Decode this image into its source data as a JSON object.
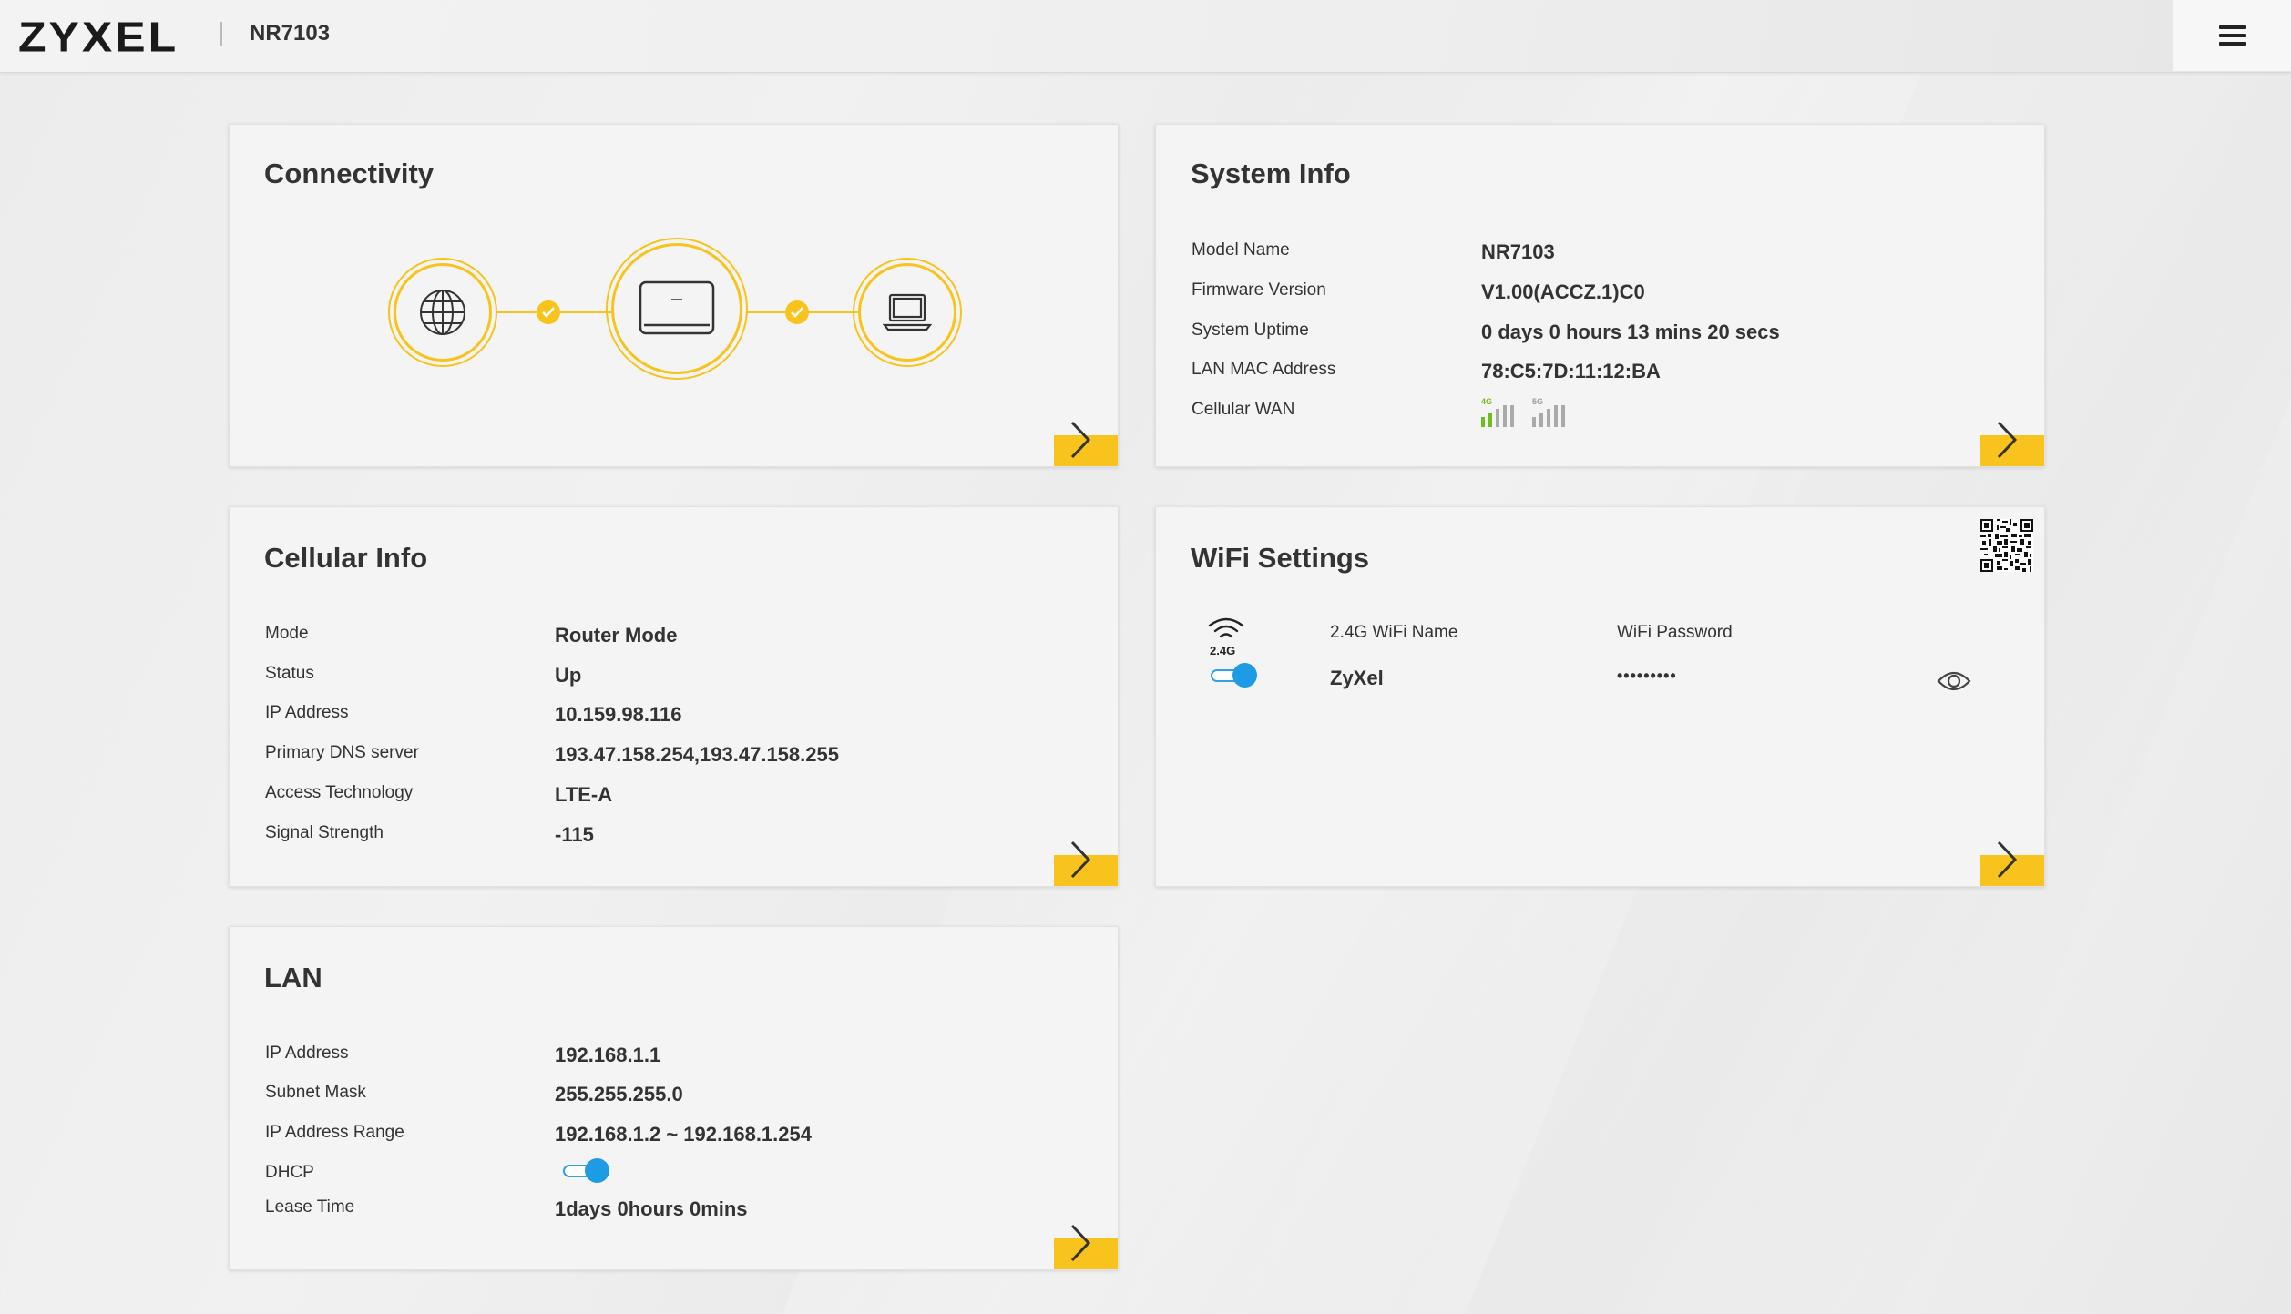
{
  "header": {
    "logo": "ZYXEL",
    "model": "NR7103",
    "menu_icon": "hamburger-menu-icon"
  },
  "accent_color": "#f7c31c",
  "toggle_color": "#1e9be5",
  "connectivity": {
    "title": "Connectivity",
    "nodes": [
      "globe-icon",
      "router-icon",
      "laptop-icon"
    ],
    "links_ok": [
      true,
      true
    ]
  },
  "system_info": {
    "title": "System Info",
    "rows": [
      {
        "label": "Model Name",
        "value": "NR7103"
      },
      {
        "label": "Firmware Version",
        "value": "V1.00(ACCZ.1)C0"
      },
      {
        "label": "System Uptime",
        "value": "0 days 0 hours 13 mins 20 secs"
      },
      {
        "label": "LAN MAC Address",
        "value": "78:C5:7D:11:12:BA"
      },
      {
        "label": "Cellular WAN",
        "value": ""
      }
    ],
    "cellular_wan": {
      "signal_4g_label": "4G",
      "signal_5g_label": "5G",
      "signal_4g_bars_active": 1,
      "signal_5g_bars_active": 0,
      "bars_total": 4
    }
  },
  "cellular_info": {
    "title": "Cellular Info",
    "rows": [
      {
        "label": "Mode",
        "value": "Router Mode"
      },
      {
        "label": "Status",
        "value": "Up"
      },
      {
        "label": "IP Address",
        "value": "10.159.98.116"
      },
      {
        "label": "Primary DNS server",
        "value": "193.47.158.254,193.47.158.255"
      },
      {
        "label": "Access Technology",
        "value": "LTE-A"
      },
      {
        "label": "Signal Strength",
        "value": "-115"
      }
    ]
  },
  "wifi_settings": {
    "title": "WiFi Settings",
    "band_label": "2.4G",
    "name_header": "2.4G WiFi Name",
    "password_header": "WiFi Password",
    "wifi_name": "ZyXel",
    "wifi_password": "•••••••••",
    "enabled": true
  },
  "lan": {
    "title": "LAN",
    "rows": [
      {
        "label": "IP Address",
        "value": "192.168.1.1"
      },
      {
        "label": "Subnet Mask",
        "value": "255.255.255.0"
      },
      {
        "label": "IP Address Range",
        "value": "192.168.1.2 ~ 192.168.1.254"
      },
      {
        "label": "DHCP",
        "value": ""
      },
      {
        "label": "Lease Time",
        "value": "1days 0hours 0mins"
      }
    ],
    "dhcp_enabled": true
  }
}
